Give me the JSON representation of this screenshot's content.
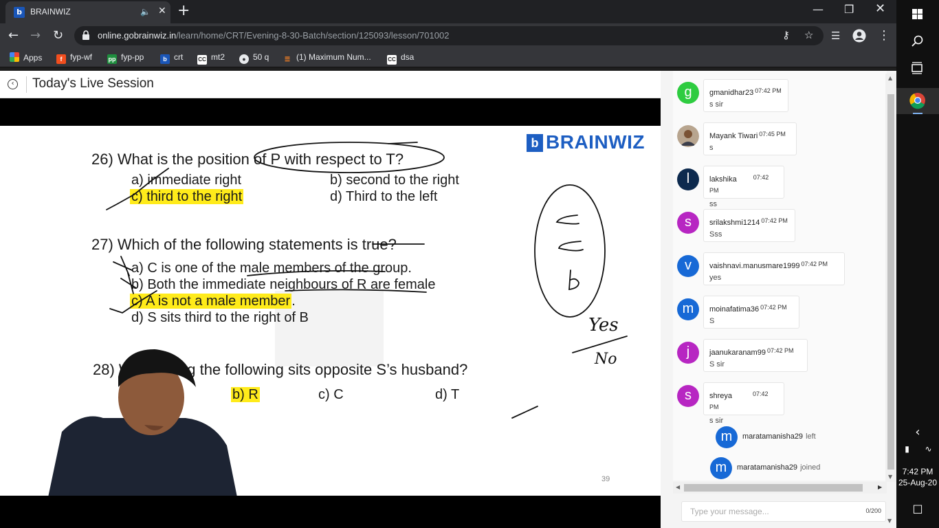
{
  "browser": {
    "tab_title": "BRAINWIZ",
    "url_host": "online.gobrainwiz.in",
    "url_path": "/learn/home/CRT/Evening-8-30-Batch/section/125093/lesson/701002",
    "bookmarks": [
      {
        "label": "Apps",
        "icon": "apps-grid-icon"
      },
      {
        "label": "fyp-wf",
        "icon": "figma-icon"
      },
      {
        "label": "fyp-pp",
        "icon": "sheet-icon"
      },
      {
        "label": "crt",
        "icon": "brainwiz-icon"
      },
      {
        "label": "mt2",
        "icon": "cc-icon"
      },
      {
        "label": "50 q",
        "icon": "globe-icon"
      },
      {
        "label": "(1) Maximum Num...",
        "icon": "stackoverflow-icon"
      },
      {
        "label": "dsa",
        "icon": "cc-icon"
      }
    ]
  },
  "page": {
    "title": "Today's Live Session"
  },
  "slide": {
    "logo_text": "BRAINWIZ",
    "q26": {
      "question": "26) What is the position of P with respect to T?",
      "a": "a) immediate right",
      "b": "b) second to the right",
      "c": "c) third to the right",
      "d": "d) Third to the left"
    },
    "q27": {
      "question": "27) Which of the following statements is true?",
      "a": "a) C is one of the male members of the group.",
      "b": "b) Both the immediate neighbours of R are female",
      "c_main": "c) A is not a male member",
      "c_tail": ".",
      "d": "d) S sits third to the right of B"
    },
    "q28": {
      "question_left": "28) Wh",
      "question_right": "ng the following sits opposite S’s husband?",
      "b": "b) R",
      "c": "c) C",
      "d": "d) T"
    },
    "page_number": "39",
    "ink_notes": [
      "Yes",
      "No"
    ]
  },
  "chat": {
    "messages": [
      {
        "initial": "g",
        "name": "gmanidhar23",
        "time": "07:42 PM",
        "text": "s sir",
        "color": "#2ecc40"
      },
      {
        "initial": "",
        "name": "Mayank Tiwari",
        "time": "07:45 PM",
        "text": "s",
        "color": "#8a6a50"
      },
      {
        "initial": "l",
        "name": "lakshika",
        "time": "07:42 PM",
        "text": "ss",
        "color": "#0d2a4e"
      },
      {
        "initial": "s",
        "name": "srilakshmi1214",
        "time": "07:42 PM",
        "text": "Sss",
        "color": "#b726c2"
      },
      {
        "initial": "v",
        "name": "vaishnavi.manusmare1999",
        "time": "07:42 PM",
        "text": "yes",
        "color": "#1769d6"
      },
      {
        "initial": "m",
        "name": "moinafatima36",
        "time": "07:42 PM",
        "text": "S",
        "color": "#1769d6"
      },
      {
        "initial": "j",
        "name": "jaanukaranam99",
        "time": "07:42 PM",
        "text": "S sir",
        "color": "#b726c2"
      },
      {
        "initial": "s",
        "name": "shreya",
        "time": "07:42 PM",
        "text": "s sir",
        "color": "#b726c2"
      }
    ],
    "events": [
      {
        "initial": "m",
        "name": "maratamanisha29",
        "action": "left",
        "color": "#1769d6"
      },
      {
        "initial": "m",
        "name": "maratamanisha29",
        "action": "joined",
        "color": "#1769d6"
      }
    ],
    "input_placeholder": "Type your message...",
    "char_count": "0/200"
  },
  "taskbar": {
    "time": "7:42 PM",
    "date": "25-Aug-20"
  }
}
